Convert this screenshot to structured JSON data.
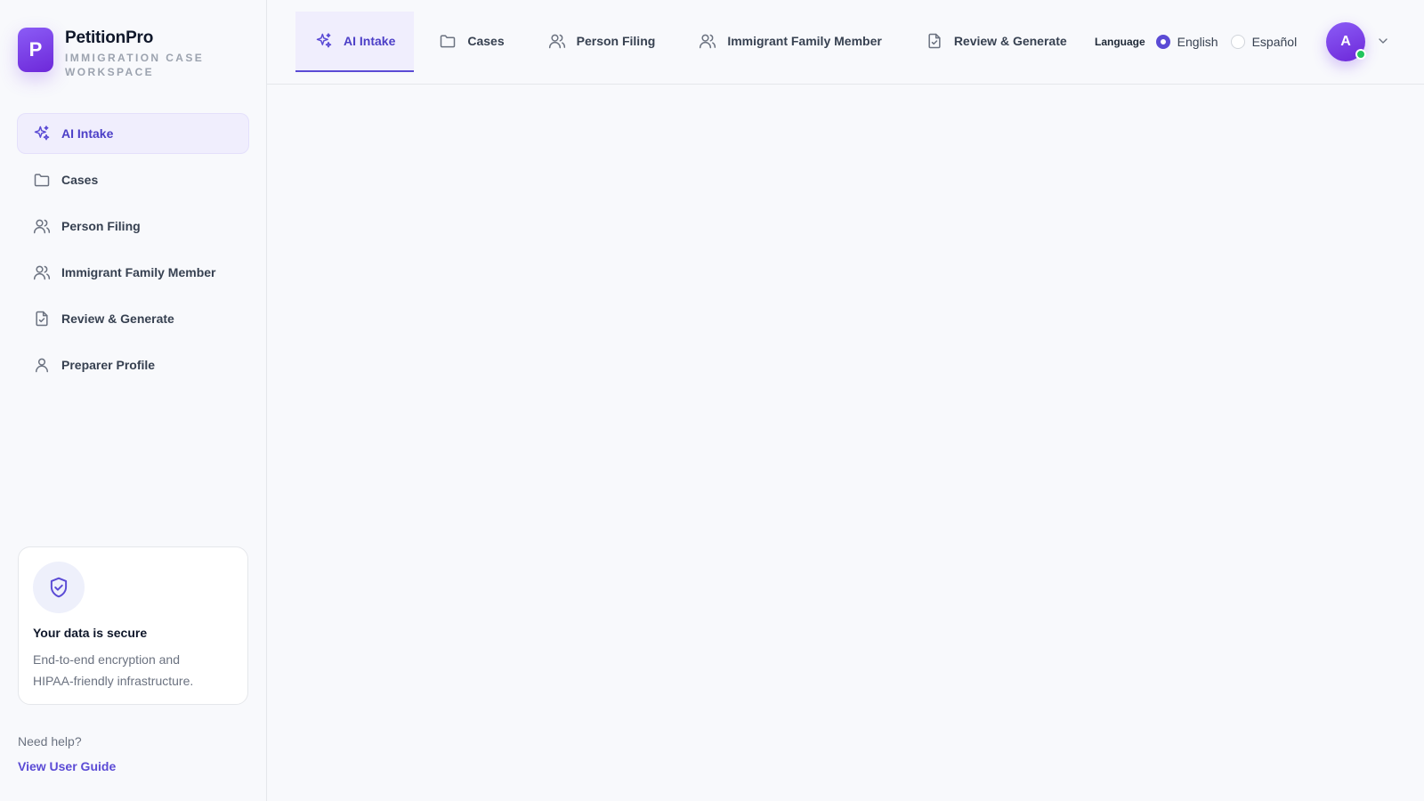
{
  "brand": {
    "name": "PetitionPro",
    "subtitle": "Immigration Case Workspace",
    "logo_letter": "P"
  },
  "sidebar": {
    "items": [
      {
        "label": "AI Intake",
        "icon": "sparkles-icon",
        "active": true
      },
      {
        "label": "Cases",
        "icon": "folder-icon"
      },
      {
        "label": "Person Filing",
        "icon": "users-icon"
      },
      {
        "label": "Immigrant Family Member",
        "icon": "users-icon"
      },
      {
        "label": "Review & Generate",
        "icon": "file-check-icon"
      },
      {
        "label": "Preparer Profile",
        "icon": "user-icon"
      }
    ]
  },
  "secure_card": {
    "icon": "shield-check-icon",
    "title": "Your data is secure",
    "description": "End-to-end encryption and HIPAA-friendly infrastructure."
  },
  "help": {
    "text": "Need help?",
    "link": "View User Guide"
  },
  "topbar": {
    "tabs": [
      {
        "label": "AI Intake",
        "icon": "sparkles-icon",
        "active": true
      },
      {
        "label": "Cases",
        "icon": "folder-icon"
      },
      {
        "label": "Person Filing",
        "icon": "users-icon"
      },
      {
        "label": "Immigrant Family Member",
        "icon": "users-icon"
      },
      {
        "label": "Review & Generate",
        "icon": "file-check-icon"
      }
    ],
    "language": {
      "label": "Language",
      "options": [
        {
          "label": "English",
          "selected": true
        },
        {
          "label": "Español",
          "selected": false
        }
      ]
    },
    "avatar": {
      "initial": "A",
      "status": "online"
    }
  },
  "colors": {
    "accent": "#5b4bd5",
    "active_bg": "#f0eefd",
    "status_online": "#22c55e"
  }
}
